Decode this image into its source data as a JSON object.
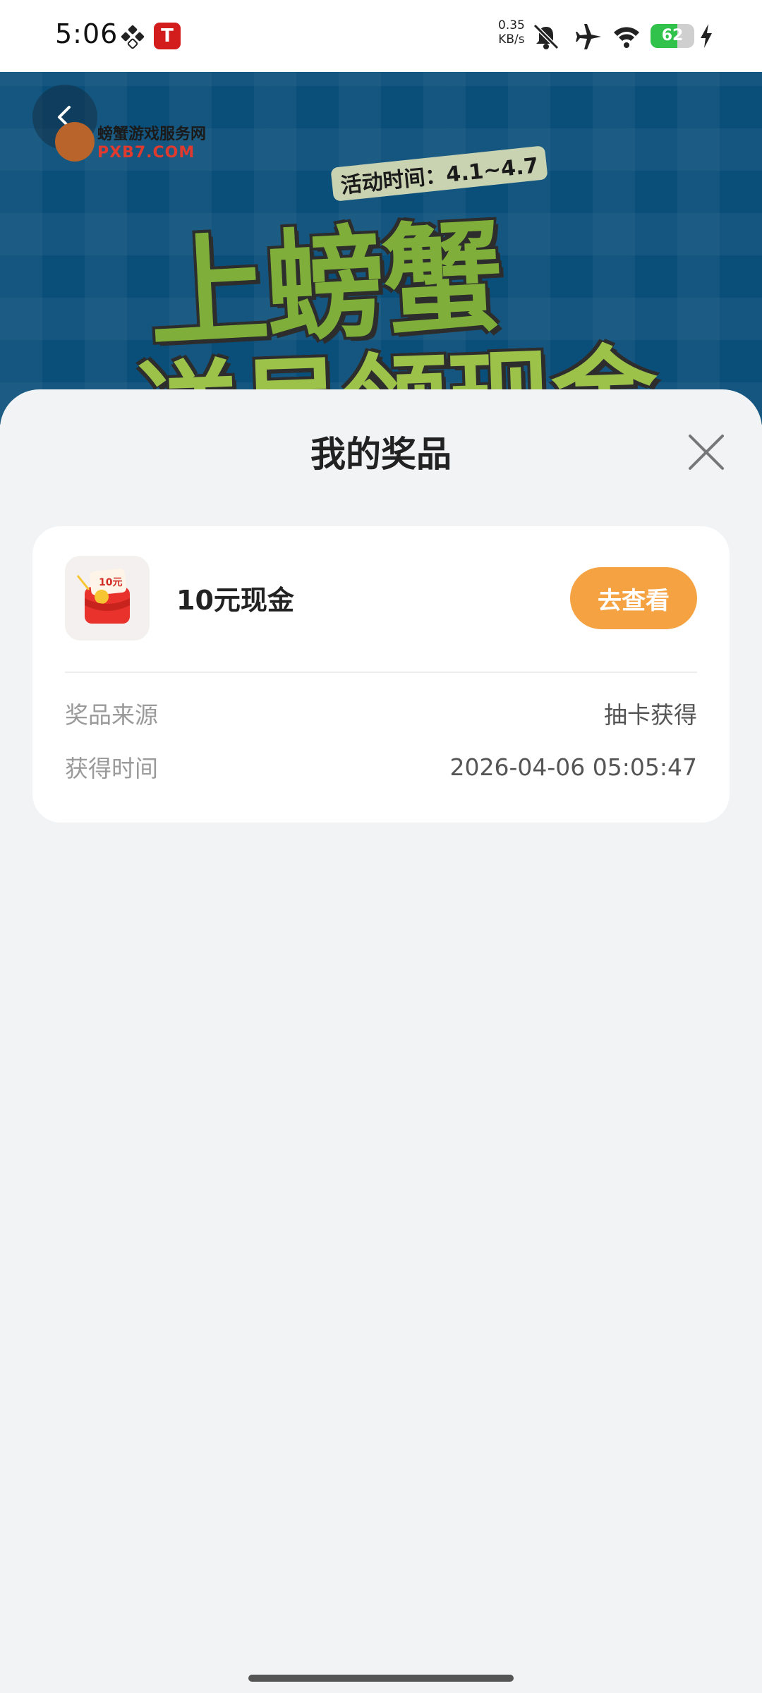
{
  "status_bar": {
    "time": "5:06",
    "speed_value": "0.35",
    "speed_unit": "KB/s",
    "battery": "62",
    "battery_level": 0.62,
    "icons": [
      "grid-icon",
      "app-t-icon",
      "mute-icon",
      "airplane-icon",
      "wifi-icon",
      "battery-icon",
      "charging-icon"
    ]
  },
  "banner": {
    "logo_cn": "螃蟹游戏服务网",
    "logo_en": "PXB7.COM",
    "activity_time": "活动时间：4.1~4.7",
    "title_line1": "上螃蟹",
    "title_line2": "送号领现金"
  },
  "sheet": {
    "title": "我的奖品",
    "prize": {
      "name": "10元现金",
      "image_badge": "10元",
      "view_button": "去查看",
      "source_label": "奖品来源",
      "source_value": "抽卡获得",
      "time_label": "获得时间",
      "time_value": "2026-04-06 05:05:47"
    }
  },
  "colors": {
    "accent": "#f5a243",
    "banner_bg": "#0a4f7a",
    "sheet_bg": "#f2f3f5"
  }
}
